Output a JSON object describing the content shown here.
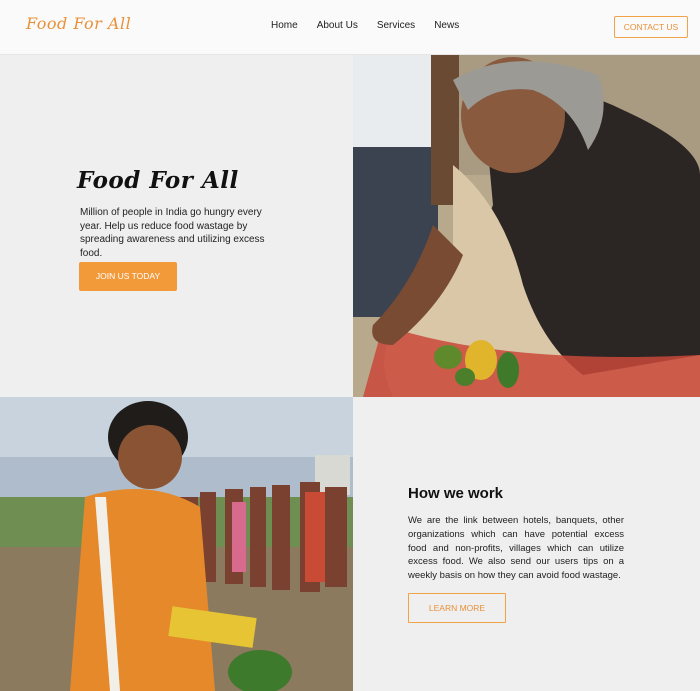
{
  "header": {
    "logo_text": "Food For All",
    "nav": [
      "Home",
      "About Us",
      "Services",
      "News"
    ],
    "contact_label": "CONTACT US"
  },
  "hero": {
    "title": "Food For All",
    "text": "Million of people in India go hungry every year. Help us reduce food wastage by spreading awareness and utilizing excess food.",
    "join_label": "JOIN US TODAY"
  },
  "how": {
    "title": "How we work",
    "text": "We are the link between hotels, banquets, other organizations which can have potential excess food and non-profits, villages which can utilize excess food. We also send our users tips on a weekly basis on how they can avoid food wastage.",
    "learn_label": "LEARN MORE"
  },
  "colors": {
    "accent": "#f29a3a",
    "background": "#efefef"
  }
}
